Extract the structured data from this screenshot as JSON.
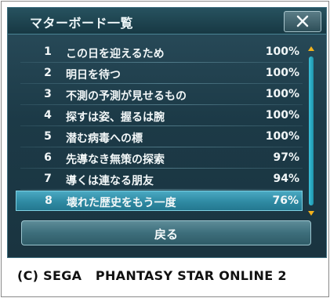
{
  "window": {
    "title": "マターボード一覧",
    "close_icon": "close-x-icon"
  },
  "list": {
    "items": [
      {
        "rank": "1",
        "name": "この日を迎えるため",
        "percent": "100%"
      },
      {
        "rank": "2",
        "name": "明日を待つ",
        "percent": "100%"
      },
      {
        "rank": "3",
        "name": "不測の予測が見せるもの",
        "percent": "100%"
      },
      {
        "rank": "4",
        "name": "探すは姿、握るは腕",
        "percent": "100%"
      },
      {
        "rank": "5",
        "name": "潜む病毒への標",
        "percent": "100%"
      },
      {
        "rank": "6",
        "name": "先導なき無策の探索",
        "percent": "97%"
      },
      {
        "rank": "7",
        "name": "導くは連なる朋友",
        "percent": "94%"
      },
      {
        "rank": "8",
        "name": "壊れた歴史をもう一度",
        "percent": "76%"
      }
    ],
    "selected_index": 7
  },
  "scrollbar": {
    "up_icon": "arrow-up-icon",
    "down_icon": "arrow-down-icon",
    "accent": "#f2b21c"
  },
  "footer": {
    "back_label": "戻る"
  },
  "copyright": "(C) SEGA   PHANTASY STAR ONLINE 2"
}
